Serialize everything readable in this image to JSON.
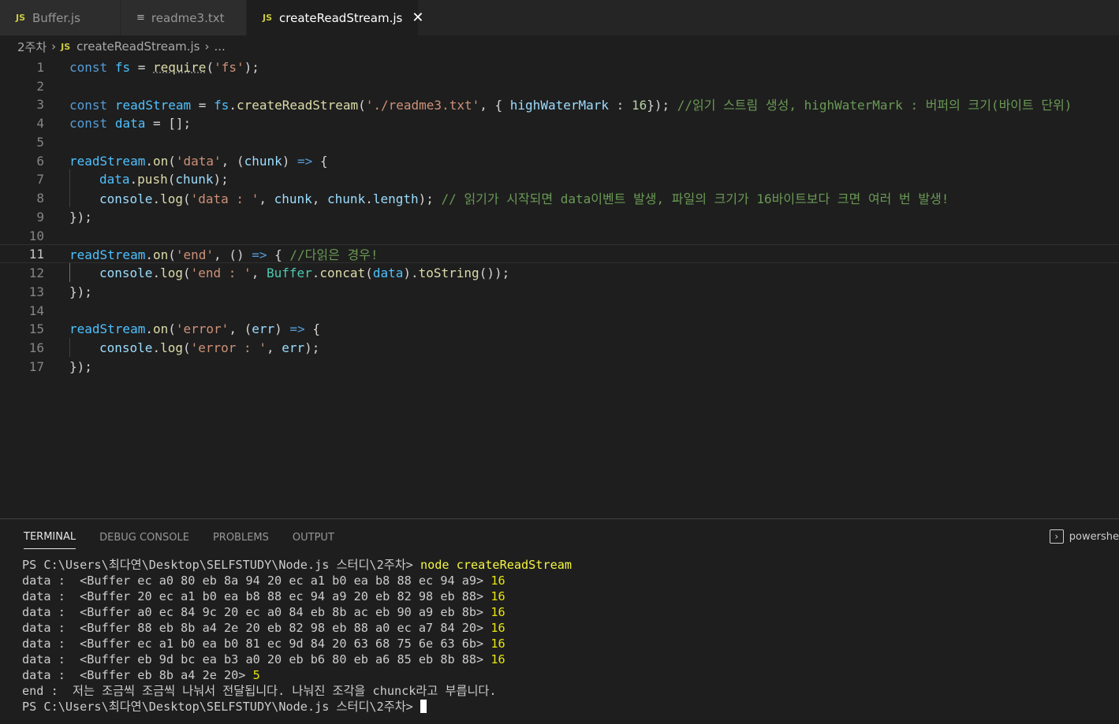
{
  "tabs": [
    {
      "label": "Buffer.js",
      "icon": "JS"
    },
    {
      "label": "readme3.txt",
      "icon": "≡"
    },
    {
      "label": "createReadStream.js",
      "icon": "JS",
      "close": "✕"
    }
  ],
  "breadcrumb": {
    "folder": "2주차",
    "icon": "JS",
    "file": "createReadStream.js",
    "more": "..."
  },
  "editor": {
    "line_numbers": [
      "1",
      "2",
      "3",
      "4",
      "5",
      "6",
      "7",
      "8",
      "9",
      "10",
      "11",
      "12",
      "13",
      "14",
      "15",
      "16",
      "17"
    ],
    "lines": {
      "l1": [
        "const",
        "fs",
        "=",
        "require",
        "(",
        "'fs'",
        ");"
      ],
      "l3": [
        "const",
        "readStream",
        "=",
        "fs",
        ".",
        "createReadStream",
        "(",
        "'./readme3.txt'",
        ", {",
        "highWaterMark",
        ":",
        "16",
        "});",
        "//읽기 스트림 생성, highWaterMark : 버퍼의 크기(바이트 단위)"
      ],
      "l4": [
        "const",
        "data",
        "= [];"
      ],
      "l6": [
        "readStream",
        ".",
        "on",
        "(",
        "'data'",
        ", (",
        "chunk",
        ")",
        "=>",
        "{"
      ],
      "l7": [
        "data",
        ".",
        "push",
        "(",
        "chunk",
        ");"
      ],
      "l8": [
        "console",
        ".",
        "log",
        "(",
        "'data : '",
        ", ",
        "chunk",
        ", ",
        "chunk",
        ".",
        "length",
        ");",
        "// 읽기가 시작되면 data이벤트 발생, 파일의 크기가 16바이트보다 크면 여러 번 발생!"
      ],
      "l9": [
        "});"
      ],
      "l11": [
        "readStream",
        ".",
        "on",
        "(",
        "'end'",
        ", ()",
        "=>",
        "{",
        "//다읽은 경우!"
      ],
      "l12": [
        "console",
        ".",
        "log",
        "(",
        "'end : '",
        ", ",
        "Buffer",
        ".",
        "concat",
        "(",
        "data",
        ").",
        "toString",
        "());"
      ],
      "l13": [
        "});"
      ],
      "l15": [
        "readStream",
        ".",
        "on",
        "(",
        "'error'",
        ", (",
        "err",
        ")",
        "=>",
        "{"
      ],
      "l16": [
        "console",
        ".",
        "log",
        "(",
        "'error : '",
        ", ",
        "err",
        ");"
      ],
      "l17": [
        "});"
      ]
    }
  },
  "panel": {
    "tabs": [
      "TERMINAL",
      "DEBUG CONSOLE",
      "PROBLEMS",
      "OUTPUT"
    ],
    "shell": "powershe",
    "prompt": "PS C:\\Users\\최다연\\Desktop\\SELFSTUDY\\Node.js 스터디\\2주차>",
    "command": "node createReadStream",
    "output": [
      {
        "text": "data :  <Buffer ec a0 80 eb 8a 94 20 ec a1 b0 ea b8 88 ec 94 a9>",
        "len": "16"
      },
      {
        "text": "data :  <Buffer 20 ec a1 b0 ea b8 88 ec 94 a9 20 eb 82 98 eb 88>",
        "len": "16"
      },
      {
        "text": "data :  <Buffer a0 ec 84 9c 20 ec a0 84 eb 8b ac eb 90 a9 eb 8b>",
        "len": "16"
      },
      {
        "text": "data :  <Buffer 88 eb 8b a4 2e 20 eb 82 98 eb 88 a0 ec a7 84 20>",
        "len": "16"
      },
      {
        "text": "data :  <Buffer ec a1 b0 ea b0 81 ec 9d 84 20 63 68 75 6e 63 6b>",
        "len": "16"
      },
      {
        "text": "data :  <Buffer eb 9d bc ea b3 a0 20 eb b6 80 eb a6 85 eb 8b 88>",
        "len": "16"
      },
      {
        "text": "data :  <Buffer eb 8b a4 2e 20>",
        "len": "5"
      }
    ],
    "end_line": "end :  저는 조금씩 조금씩 나눠서 전달됩니다. 나눠진 조각을 chunck라고 부릅니다.",
    "final_prompt": "PS C:\\Users\\최다연\\Desktop\\SELFSTUDY\\Node.js 스터디\\2주차>"
  },
  "colors": {
    "keyword": "#569cd6",
    "string": "#ce9178",
    "comment": "#6a9955",
    "function": "#dcdcaa",
    "variable": "#9cdcfe",
    "number": "#b5cea8"
  }
}
